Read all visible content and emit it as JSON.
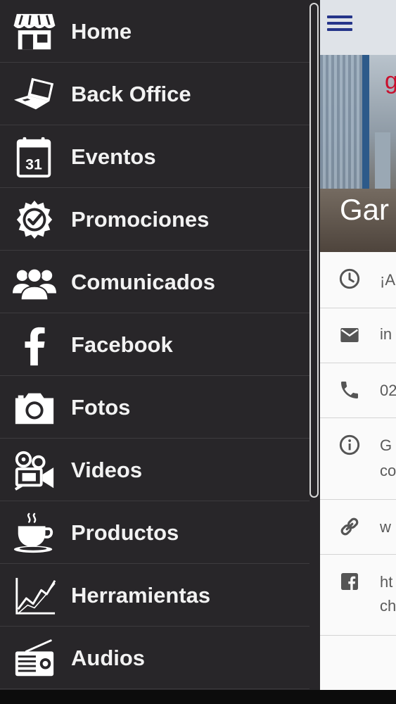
{
  "drawer": {
    "items": [
      {
        "label": "Home",
        "icon": "store-icon"
      },
      {
        "label": "Back Office",
        "icon": "laptop-icon"
      },
      {
        "label": "Eventos",
        "icon": "calendar-icon",
        "icon_text": "31"
      },
      {
        "label": "Promociones",
        "icon": "badge-check-icon"
      },
      {
        "label": "Comunicados",
        "icon": "group-icon"
      },
      {
        "label": "Facebook",
        "icon": "facebook-icon"
      },
      {
        "label": "Fotos",
        "icon": "camera-icon"
      },
      {
        "label": "Videos",
        "icon": "video-camera-icon"
      },
      {
        "label": "Productos",
        "icon": "coffee-cup-icon"
      },
      {
        "label": "Herramientas",
        "icon": "line-chart-icon"
      },
      {
        "label": "Audios",
        "icon": "radio-icon"
      }
    ]
  },
  "app": {
    "menu_icon": "hamburger-icon",
    "hero": {
      "title": "Gar",
      "mark": "g"
    },
    "info": [
      {
        "icon": "clock-icon",
        "text": "¡A"
      },
      {
        "icon": "mail-icon",
        "text": "in"
      },
      {
        "icon": "phone-icon",
        "text": "02"
      },
      {
        "icon": "info-icon",
        "text": "G",
        "text2": "co"
      },
      {
        "icon": "link-icon",
        "text": "w"
      },
      {
        "icon": "facebook-square-icon",
        "text": "ht",
        "text2": "ch"
      }
    ]
  },
  "colors": {
    "drawer_bg": "#282629",
    "divider": "#3d3b3e",
    "accent": "#25358a",
    "hero_red": "#c8102e"
  }
}
